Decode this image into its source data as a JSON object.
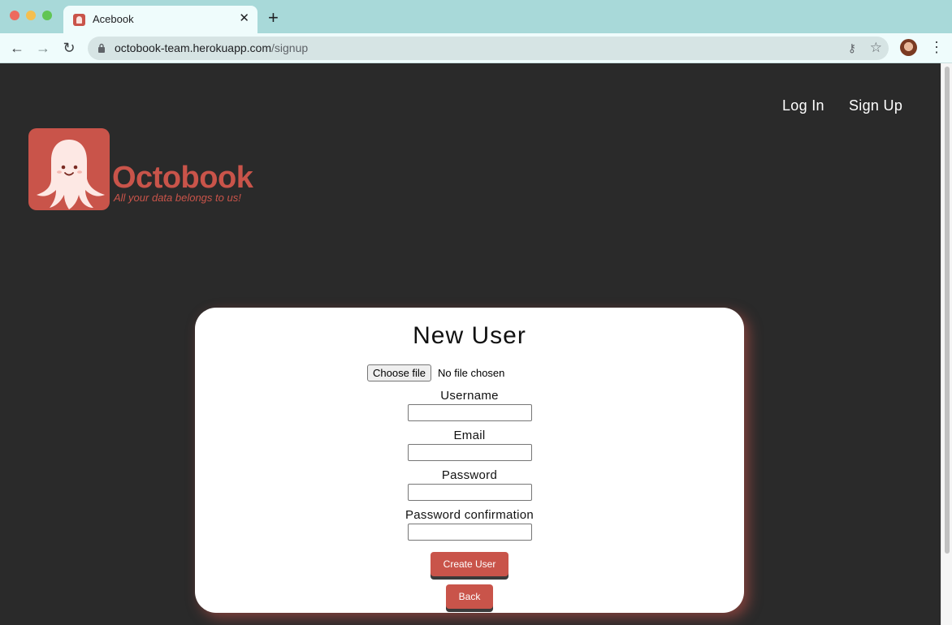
{
  "browser": {
    "tab_title": "Acebook",
    "tab_close": "✕",
    "new_tab": "+",
    "url_host": "octobook-team.herokuapp.com",
    "url_path": "/signup"
  },
  "nav": {
    "login": "Log In",
    "signup": "Sign Up"
  },
  "logo": {
    "name": "Octobook",
    "tagline": "All your data belongs to us!",
    "brand_color": "#c9544a"
  },
  "form": {
    "title": "New User",
    "file_button": "Choose file",
    "file_status": "No file chosen",
    "username_label": "Username",
    "username_value": "",
    "email_label": "Email",
    "email_value": "",
    "password_label": "Password",
    "password_value": "",
    "password_confirmation_label": "Password confirmation",
    "password_confirmation_value": "",
    "submit_label": "Create User",
    "back_label": "Back"
  },
  "icons": [
    "back-arrow-icon",
    "forward-arrow-icon",
    "reload-icon",
    "lock-icon",
    "key-icon",
    "star-icon",
    "kebab-menu-icon",
    "octopus-icon"
  ]
}
